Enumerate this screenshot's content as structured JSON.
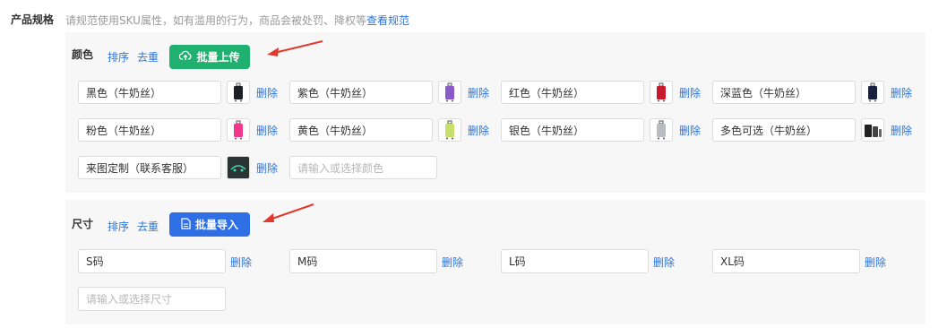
{
  "header": {
    "label": "产品规格",
    "note": "请规范使用SKU属性，如有滥用的行为，商品会被处罚、降权等",
    "link": "查看规范"
  },
  "color_section": {
    "title": "颜色",
    "sort_label": "排序",
    "dedupe_label": "去重",
    "upload_button": "批量上传",
    "upload_icon": "cloud-upload-icon",
    "delete_label": "删除",
    "items": [
      {
        "value": "黑色（牛奶丝）",
        "swatch": "#1d1f25"
      },
      {
        "value": "紫色（牛奶丝）",
        "swatch": "#8a5ac8"
      },
      {
        "value": "红色（牛奶丝）",
        "swatch": "#c8182b"
      },
      {
        "value": "深蓝色（牛奶丝）",
        "swatch": "#16223e"
      },
      {
        "value": "粉色（牛奶丝）",
        "swatch": "#f0388e"
      },
      {
        "value": "黄色（牛奶丝）",
        "swatch": "#c7e06b"
      },
      {
        "value": "银色（牛奶丝）",
        "swatch": "#b9bcc2"
      },
      {
        "value": "多色可选（牛奶丝）",
        "swatch": "#222222"
      },
      {
        "value": "来图定制（联系客服）",
        "swatch": "#2a3433"
      }
    ],
    "input_placeholder": "请输入或选择颜色"
  },
  "size_section": {
    "title": "尺寸",
    "sort_label": "排序",
    "dedupe_label": "去重",
    "import_button": "批量导入",
    "import_icon": "document-icon",
    "delete_label": "删除",
    "items": [
      {
        "value": "S码"
      },
      {
        "value": "M码"
      },
      {
        "value": "L码"
      },
      {
        "value": "XL码"
      }
    ],
    "input_placeholder": "请输入或选择尺寸"
  },
  "colors": {
    "link": "#2d74d7",
    "green_button": "#20b06f",
    "blue_button": "#2f6fe6",
    "annotation_arrow": "#e2392c",
    "panel_bg": "#f7f7f7"
  }
}
